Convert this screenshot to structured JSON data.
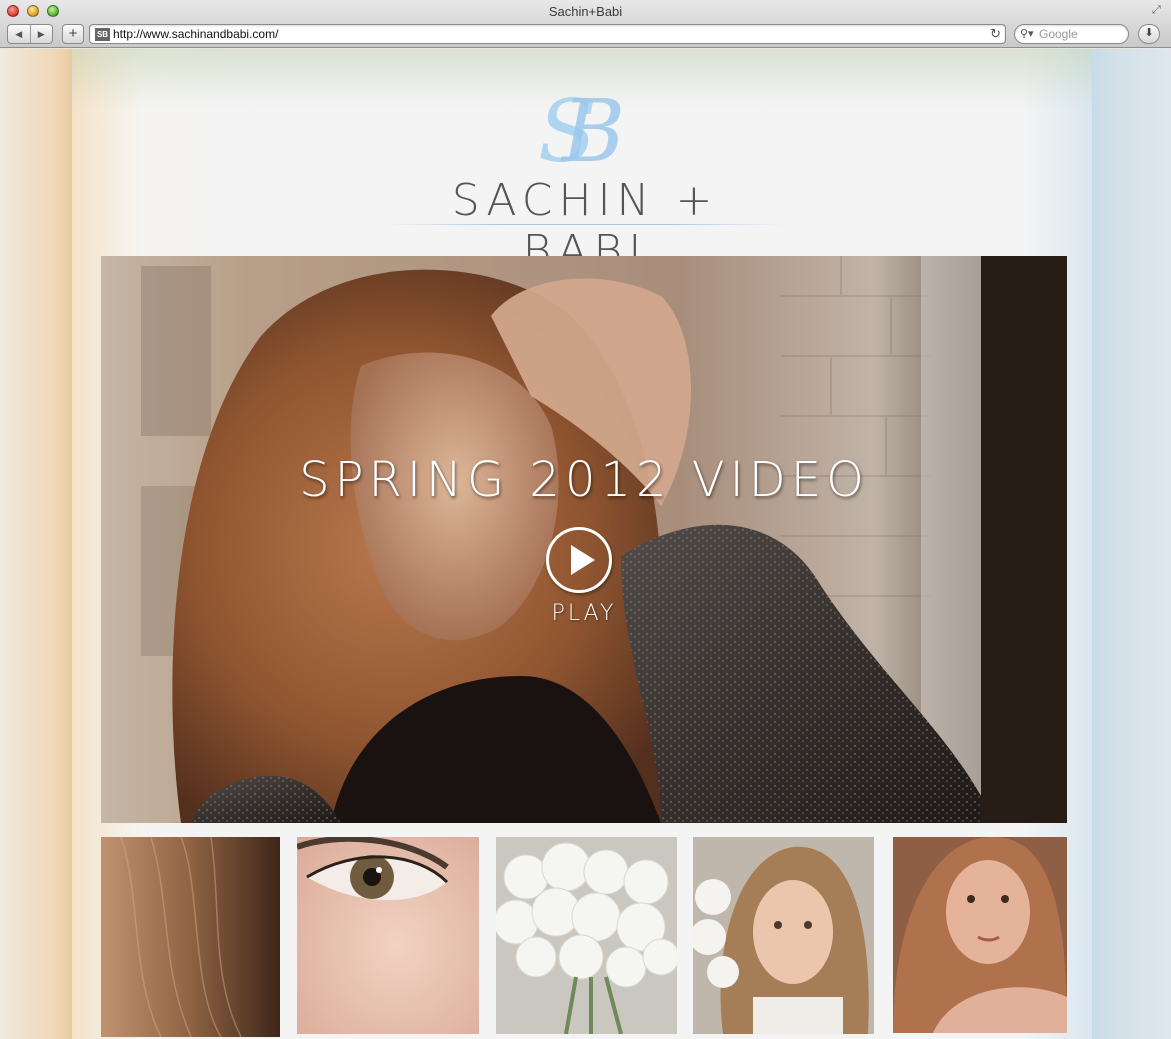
{
  "browser": {
    "window_title": "Sachin+Babi",
    "url": "http://www.sachinandbabi.com/",
    "favicon_text": "SB",
    "search_placeholder": "Google",
    "back_icon": "back-arrow-icon",
    "forward_icon": "forward-arrow-icon",
    "add_icon": "plus-icon",
    "reload_icon": "reload-icon",
    "download_icon": "download-icon"
  },
  "site": {
    "logo_monogram": "SB",
    "logo_text": "SACHIN + BABI",
    "accent_color": "#a9cfef"
  },
  "hero": {
    "title": "SPRING 2012 VIDEO",
    "play_label": "PLAY"
  },
  "thumbnails": [
    {
      "subject": "hair close-up"
    },
    {
      "subject": "eye close-up"
    },
    {
      "subject": "white flower bouquet"
    },
    {
      "subject": "model with flowers"
    },
    {
      "subject": "model portrait"
    }
  ]
}
